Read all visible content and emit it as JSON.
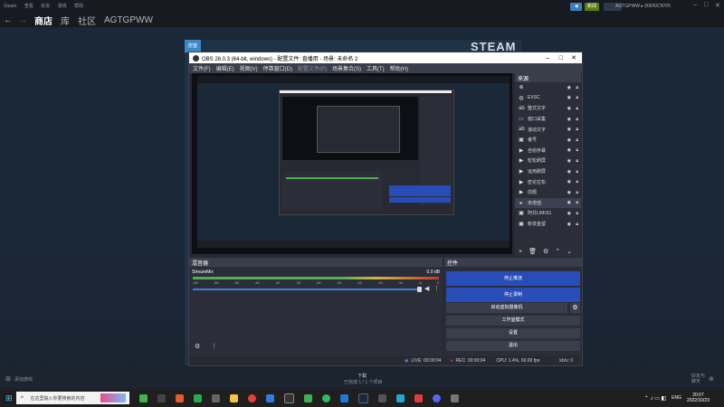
{
  "steam": {
    "menu": [
      "Steam",
      "查看",
      "好友",
      "游戏",
      "帮助"
    ],
    "nav": [
      "商店",
      "库",
      "社区",
      "AGTGPWW"
    ],
    "back_icon": "arrow-left-icon",
    "forward_icon": "arrow-right-icon",
    "badge_new": "新闻",
    "account": "AGTGPWW ▸ 000/5/CNY/5",
    "logo": "STEAM",
    "strip_label": "愿望",
    "footer": {
      "add_game": "添加游戏",
      "downloads": "下载",
      "downloads_status": "已完成 1 / 1 个项目",
      "friends": "好友与\n聊天"
    }
  },
  "obs": {
    "title": "OBS 28.0.3 (64-bit, windows) - 配置文件: 直播用 - 场景: 未命名 2",
    "menu": [
      "文件(F)",
      "编辑(E)",
      "视图(V)",
      "停靠窗口(D)",
      "配置文件(P)",
      "场景集合(S)",
      "工具(T)",
      "帮助(H)"
    ],
    "sources_title": "来源",
    "sources": [
      {
        "name": "",
        "icon": "pin-icon"
      },
      {
        "name": "EXSC",
        "icon": "globe-icon"
      },
      {
        "name": "整式文字",
        "icon": "text-icon"
      },
      {
        "name": "窗口采集",
        "icon": "window-icon"
      },
      {
        "name": "滚动文字",
        "icon": "text-icon"
      },
      {
        "name": "番号",
        "icon": "image-icon"
      },
      {
        "name": "自愈序幕",
        "icon": "play-icon"
      },
      {
        "name": "轮轮刷屏",
        "icon": "play-icon"
      },
      {
        "name": "运用刷屏",
        "icon": "play-icon"
      },
      {
        "name": "密论拉松",
        "icon": "play-icon"
      },
      {
        "name": "前题",
        "icon": "play-icon"
      },
      {
        "name": "未增值",
        "icon": "folder-icon"
      },
      {
        "name": "阿兑LIMOG",
        "icon": "image-icon"
      },
      {
        "name": "新伎金留",
        "icon": "image-icon"
      }
    ],
    "mixer_title": "混音器",
    "mixer": {
      "channel": "StreamMix",
      "db": "0.0 dB",
      "scale": [
        "-60",
        "-55",
        "-50",
        "-45",
        "-40",
        "-35",
        "-30",
        "-25",
        "-20",
        "-15",
        "-10",
        "-5",
        "0"
      ]
    },
    "controls_title": "控件",
    "controls": {
      "stop_stream": "停止推流",
      "stop_record": "停止录制",
      "virtual_cam": "启动虚拟摄像机",
      "studio_mode": "工作室模式",
      "settings": "设置",
      "exit": "退出"
    },
    "status": {
      "live": "LIVE: 00:00:04",
      "rec": "REC: 00:00:04",
      "cpu": "CPU: 1.4%, 60.00 fps",
      "kbps": "kb/s: 0"
    }
  },
  "taskbar": {
    "search_placeholder": "在这里输入你要搜索的内容",
    "lang": "ENG",
    "time": "20:07",
    "date": "2022/10/23"
  },
  "colors": {
    "accent_blue": "#284cb8",
    "steam_bg": "#1b2838",
    "obs_dark": "#272a33"
  }
}
